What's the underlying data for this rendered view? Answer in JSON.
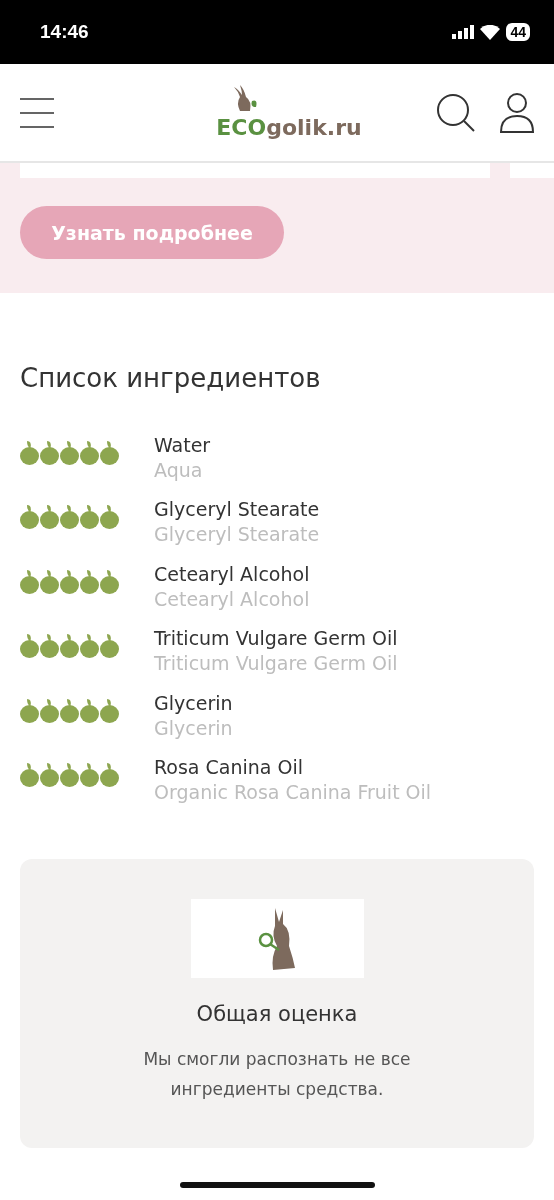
{
  "status_bar": {
    "time": "14:46",
    "battery": "44"
  },
  "header": {
    "logo": {
      "eco": "ECO",
      "rest": "golik.ru"
    }
  },
  "promo": {
    "button": "Узнать подробнее"
  },
  "ingredients": {
    "title": "Список ингредиентов",
    "items": [
      {
        "name": "Water",
        "inci": "Aqua",
        "stars": 5
      },
      {
        "name": "Glyceryl Stearate",
        "inci": "Glyceryl Stearate",
        "stars": 5
      },
      {
        "name": "Cetearyl Alcohol",
        "inci": "Cetearyl Alcohol",
        "stars": 5
      },
      {
        "name": "Triticum Vulgare Germ Oil",
        "inci": "Triticum Vulgare Germ Oil",
        "stars": 5
      },
      {
        "name": "Glycerin",
        "inci": "Glycerin",
        "stars": 5
      },
      {
        "name": "Rosa Canina Oil",
        "inci": "Organic Rosa Canina Fruit Oil",
        "stars": 5
      }
    ]
  },
  "summary": {
    "title": "Общая оценка",
    "text": "Мы смогли распознать не все ингредиенты средства."
  }
}
